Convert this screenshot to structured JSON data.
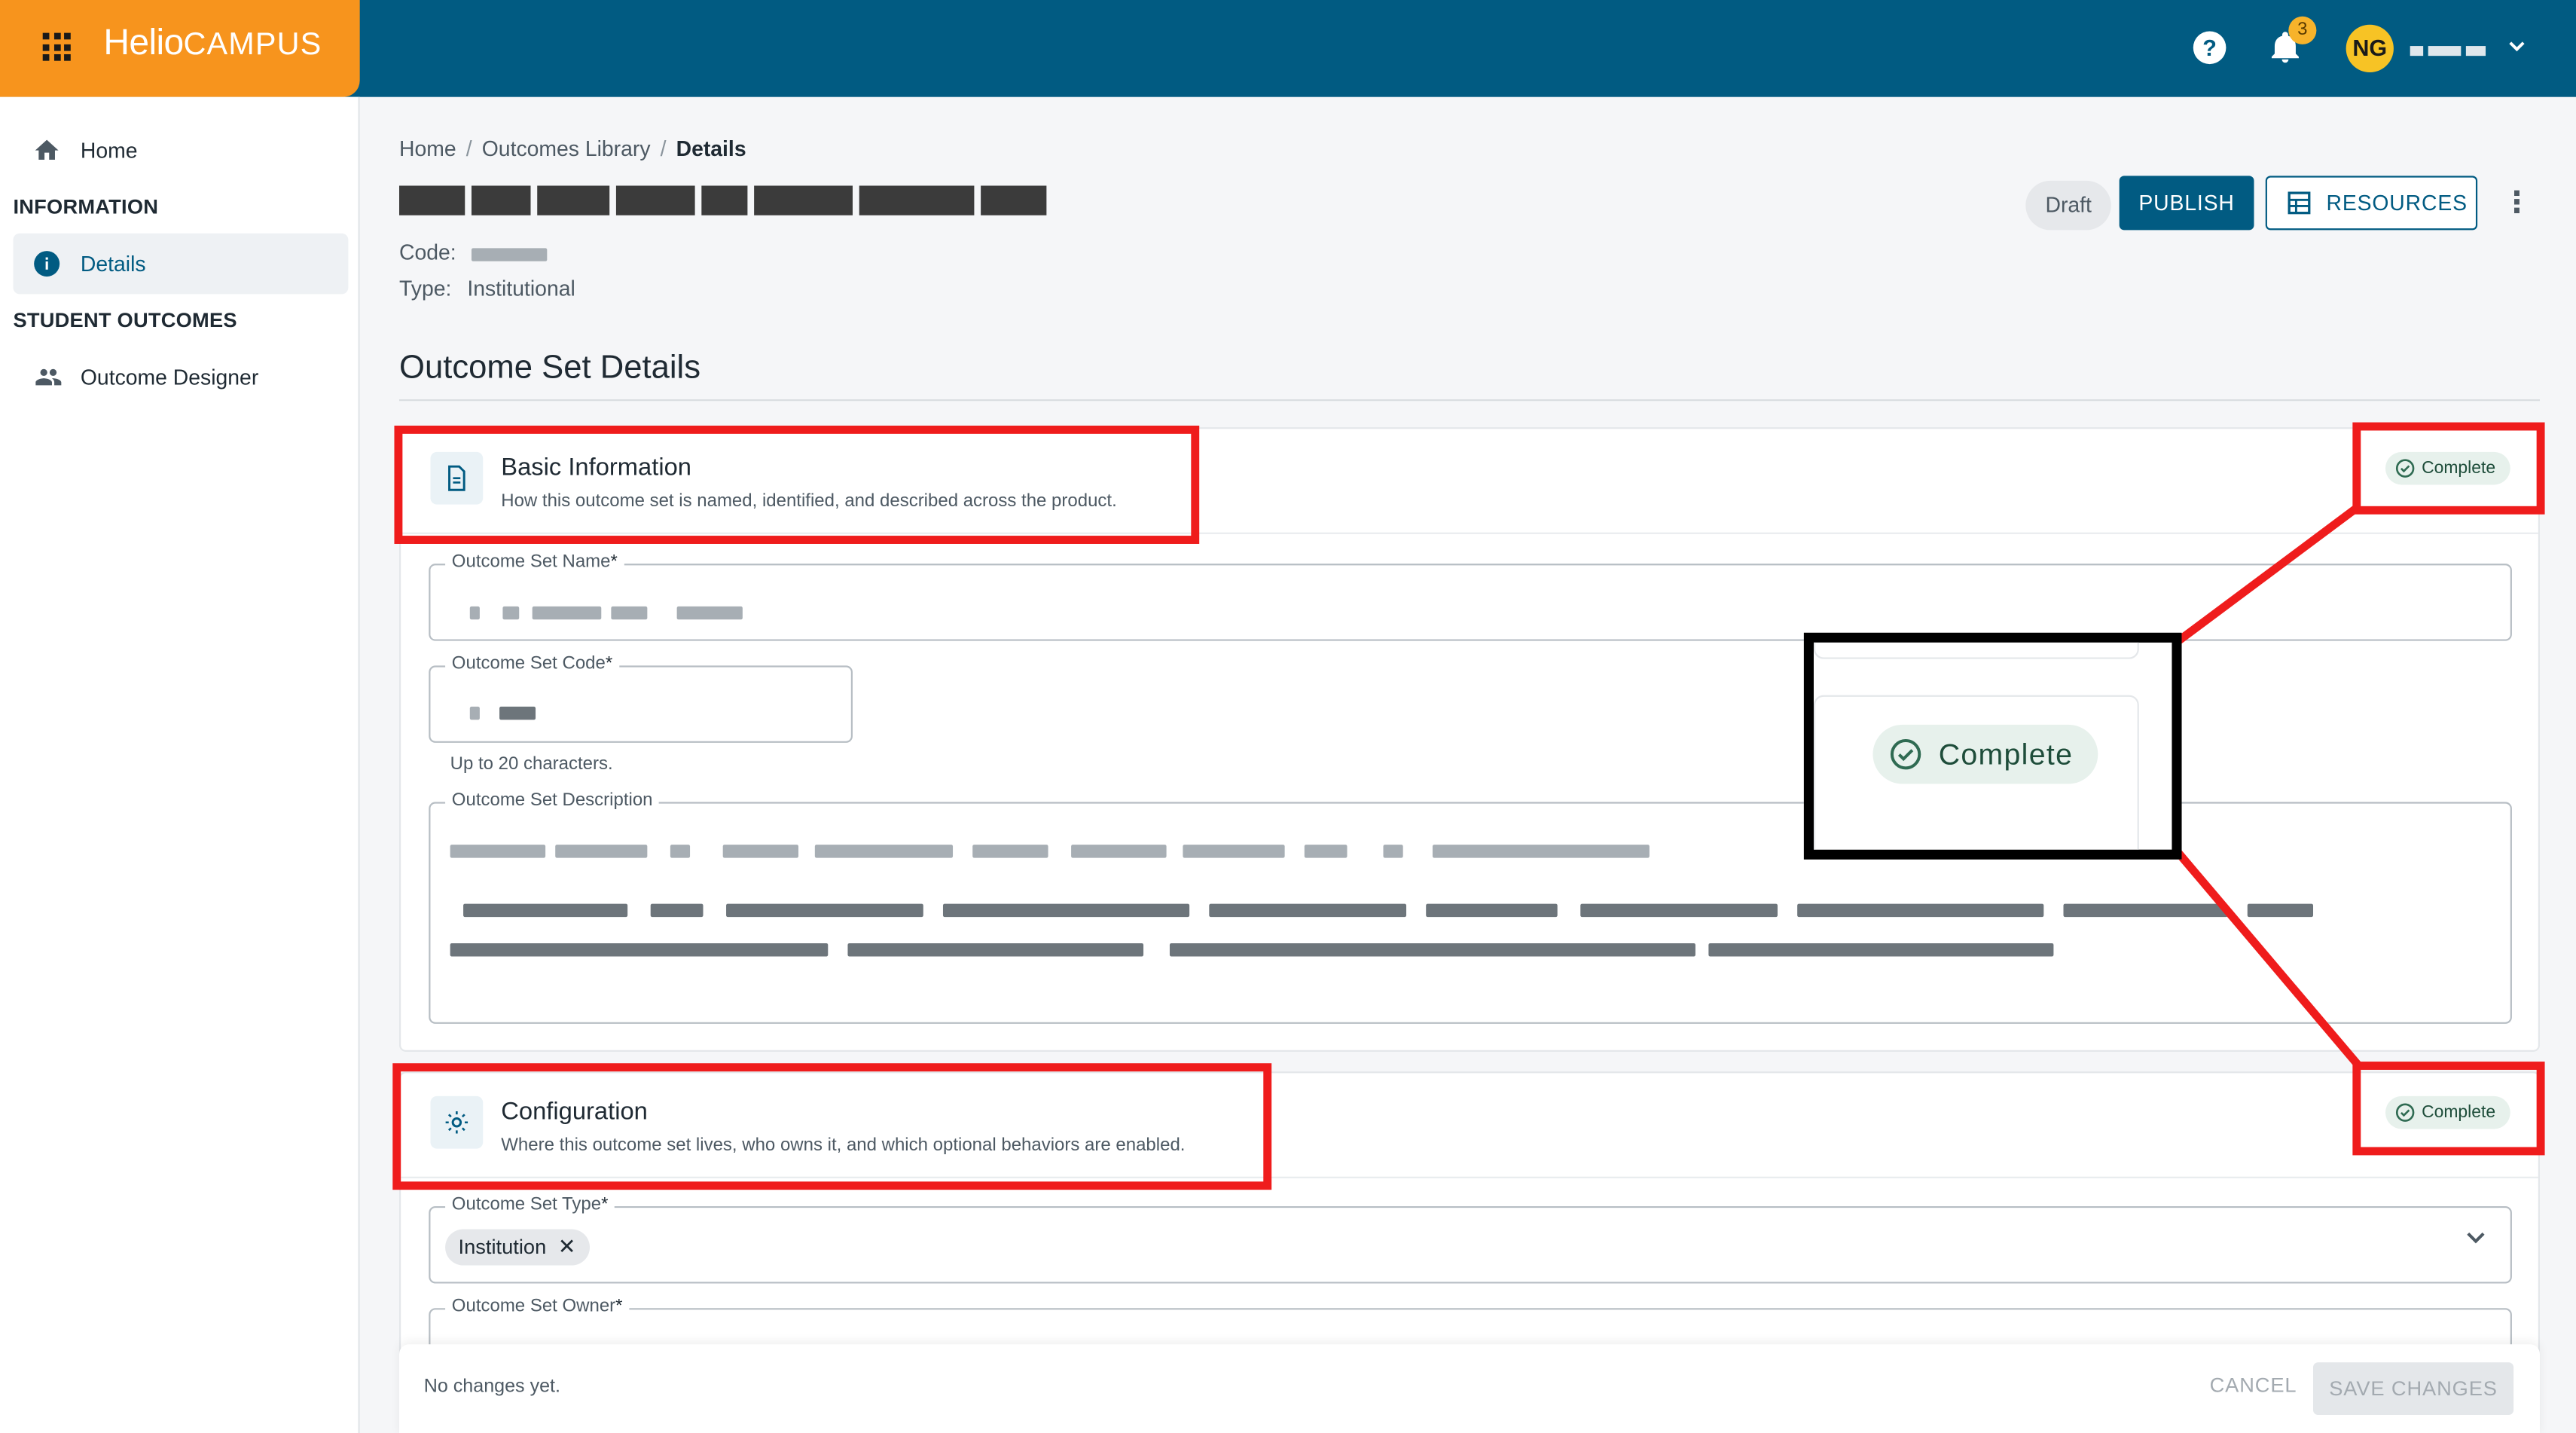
{
  "app": {
    "brand_main": "Helio",
    "brand_sub": "CAMPUS"
  },
  "header": {
    "help_label": "?",
    "notification_count": "3",
    "avatar_initials": "NG"
  },
  "sidebar": {
    "home": "Home",
    "section_information": "INFORMATION",
    "details": "Details",
    "section_outcomes": "STUDENT OUTCOMES",
    "outcome_designer": "Outcome Designer"
  },
  "breadcrumb": {
    "home": "Home",
    "library": "Outcomes Library",
    "current": "Details",
    "separator": "/"
  },
  "page": {
    "code_label": "Code:",
    "type_label": "Type:",
    "type_value": "Institutional",
    "status": "Draft",
    "publish_label": "PUBLISH",
    "resources_label": "RESOURCES",
    "more_label": "⋮",
    "section_title": "Outcome Set Details"
  },
  "basic_info": {
    "title": "Basic Information",
    "subtitle": "How this outcome set is named, identified, and described across the product.",
    "status": "Complete",
    "name_label": "Outcome Set Name",
    "code_label": "Outcome Set Code",
    "code_helper": "Up to 20 characters.",
    "description_label": "Outcome Set Description",
    "required_mark": "*"
  },
  "configuration": {
    "title": "Configuration",
    "subtitle": "Where this outcome set lives, who owns it, and which optional behaviors are enabled.",
    "status": "Complete",
    "type_label": "Outcome Set Type",
    "type_value": "Institution",
    "owner_label": "Outcome Set Owner"
  },
  "footer": {
    "status": "No changes yet.",
    "cancel_label": "CANCEL",
    "save_label": "SAVE CHANGES"
  },
  "annotation": {
    "zoom_label": "Complete"
  },
  "colors": {
    "topbar": "#015b82",
    "brand": "#f7941d",
    "primary": "#015b82",
    "complete_bg": "#e7f1ec",
    "highlight": "#ef1c1c"
  }
}
